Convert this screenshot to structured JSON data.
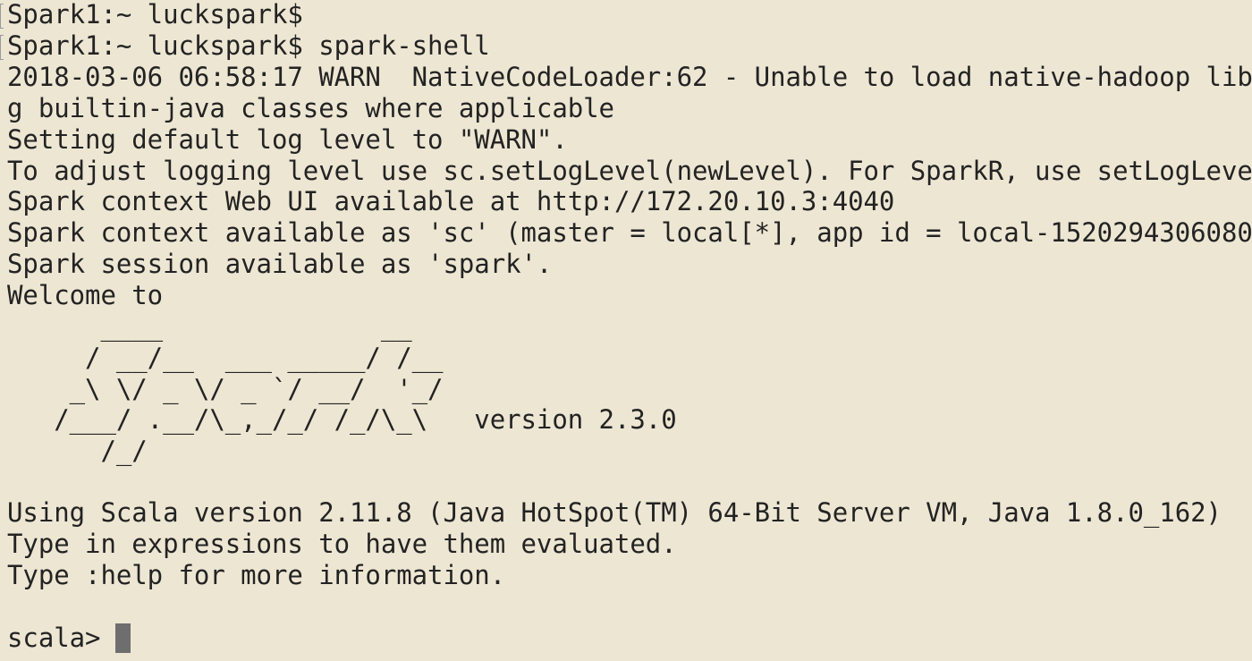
{
  "terminal": {
    "lines": [
      "Spark1:~ luckspark$",
      "Spark1:~ luckspark$ spark-shell",
      "2018-03-06 06:58:17 WARN  NativeCodeLoader:62 - Unable to load native-hadoop lib",
      "g builtin-java classes where applicable",
      "Setting default log level to \"WARN\".",
      "To adjust logging level use sc.setLogLevel(newLevel). For SparkR, use setLogLeve",
      "Spark context Web UI available at http://172.20.10.3:4040",
      "Spark context available as 'sc' (master = local[*], app id = local-1520294306080",
      "Spark session available as 'spark'.",
      "Welcome to",
      "      ____              __",
      "     / __/__  ___ _____/ /__",
      "    _\\ \\/ _ \\/ _ `/ __/  '_/",
      "   /___/ .__/\\_,_/_/ /_/\\_\\   version 2.3.0",
      "      /_/",
      "",
      "Using Scala version 2.11.8 (Java HotSpot(TM) 64-Bit Server VM, Java 1.8.0_162)",
      "Type in expressions to have them evaluated.",
      "Type :help for more information.",
      "",
      "scala> "
    ]
  },
  "colors": {
    "background": "#ede6d3",
    "text": "#232323",
    "cursor": "#6e6e6e"
  }
}
